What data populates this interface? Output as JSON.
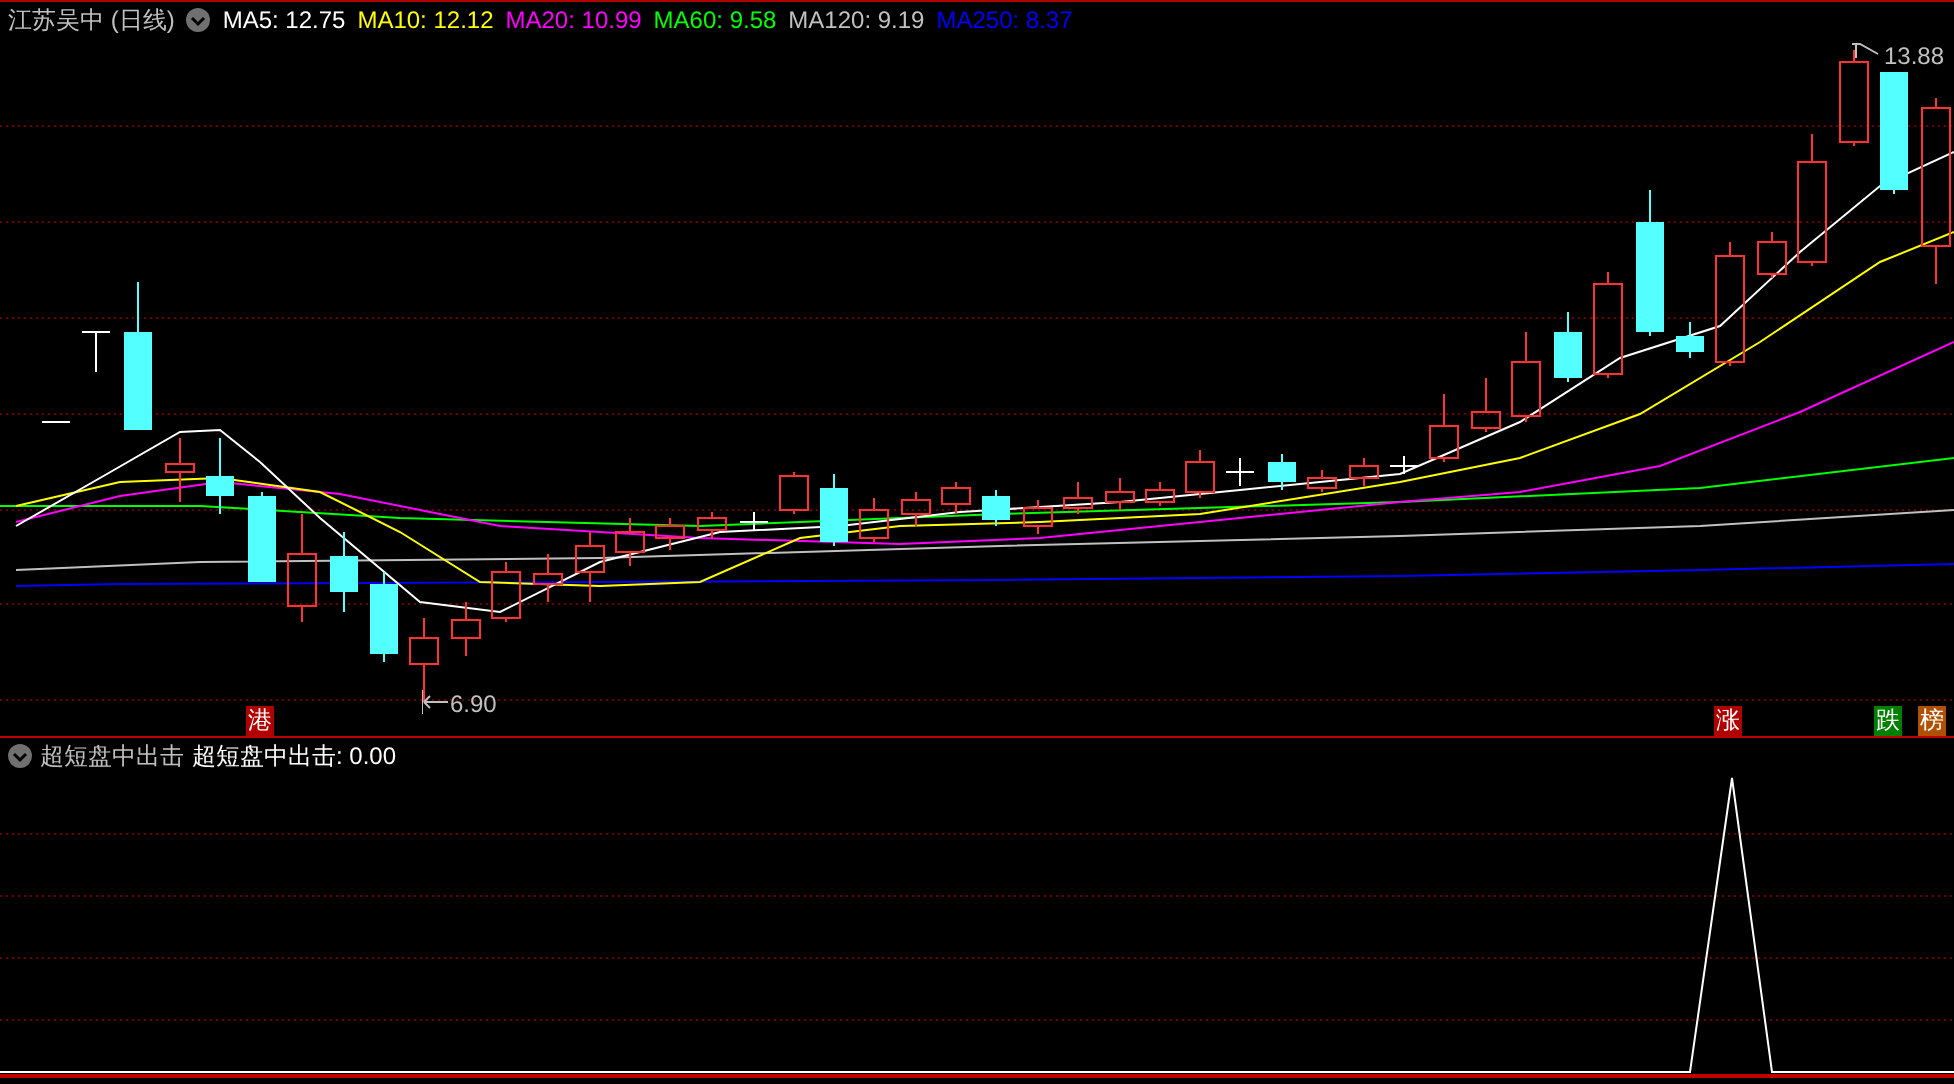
{
  "title": "江苏吴中 (日线)",
  "ma_legend": [
    {
      "label": "MA5: 12.75",
      "color": "#ffffff"
    },
    {
      "label": "MA10: 12.12",
      "color": "#ffff00"
    },
    {
      "label": "MA20: 10.99",
      "color": "#ff00ff"
    },
    {
      "label": "MA60: 9.58",
      "color": "#00ff00"
    },
    {
      "label": "MA120: 9.19",
      "color": "#c0c0c0"
    },
    {
      "label": "MA250: 8.37",
      "color": "#0000ff"
    }
  ],
  "price_high": "13.88",
  "price_low": "6.90",
  "markers": [
    {
      "text": "港",
      "color": "#b00000"
    },
    {
      "text": "涨",
      "color": "#b00000"
    },
    {
      "text": "跌",
      "color": "#008000"
    },
    {
      "text": "榜",
      "color": "#b05000"
    }
  ],
  "indicator": {
    "name": "超短盘中出击",
    "reading": "超短盘中出击: 0.00"
  }
}
